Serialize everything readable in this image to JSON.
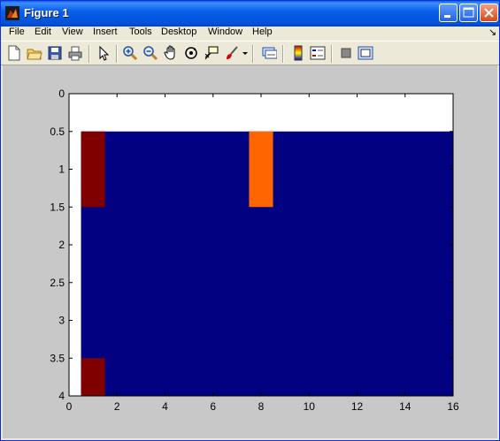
{
  "window": {
    "title": "Figure 1"
  },
  "menu": {
    "items": [
      "File",
      "Edit",
      "View",
      "Insert",
      "Tools",
      "Desktop",
      "Window",
      "Help"
    ],
    "chevron": "↘"
  },
  "toolbar": {
    "icons": [
      "new-figure-icon",
      "open-file-icon",
      "save-icon",
      "print-icon",
      "pointer-icon",
      "zoom-in-icon",
      "zoom-out-icon",
      "pan-icon",
      "rotate-3d-icon",
      "data-cursor-icon",
      "brush-icon",
      "brush-dropdown-icon",
      "link-plot-icon",
      "colorbar-icon",
      "legend-icon",
      "hide-plot-tools-icon",
      "show-plot-tools-icon"
    ]
  },
  "chart_data": {
    "type": "heatmap",
    "title": "",
    "xlabel": "",
    "ylabel": "",
    "xlim": [
      0,
      16
    ],
    "ylim": [
      0,
      4
    ],
    "y_direction": "reversed",
    "x_ticks": [
      "0",
      "2",
      "4",
      "6",
      "8",
      "10",
      "12",
      "14",
      "16"
    ],
    "y_ticks": [
      "0",
      "0.5",
      "1",
      "1.5",
      "2",
      "2.5",
      "3",
      "3.5",
      "4"
    ],
    "cells": [
      {
        "x": [
          0.5,
          1.5
        ],
        "y": [
          0.5,
          1.5
        ],
        "color": "#800000"
      },
      {
        "x": [
          7.5,
          8.5
        ],
        "y": [
          0.5,
          1.5
        ],
        "color": "#ff6600"
      },
      {
        "x": [
          0.5,
          1.5
        ],
        "y": [
          3.5,
          4.5
        ],
        "color": "#800000"
      }
    ],
    "image_extent": {
      "x": [
        0.5,
        16.5
      ],
      "y": [
        0.5,
        4.5
      ]
    },
    "background_color": "#000080",
    "grid": false
  }
}
